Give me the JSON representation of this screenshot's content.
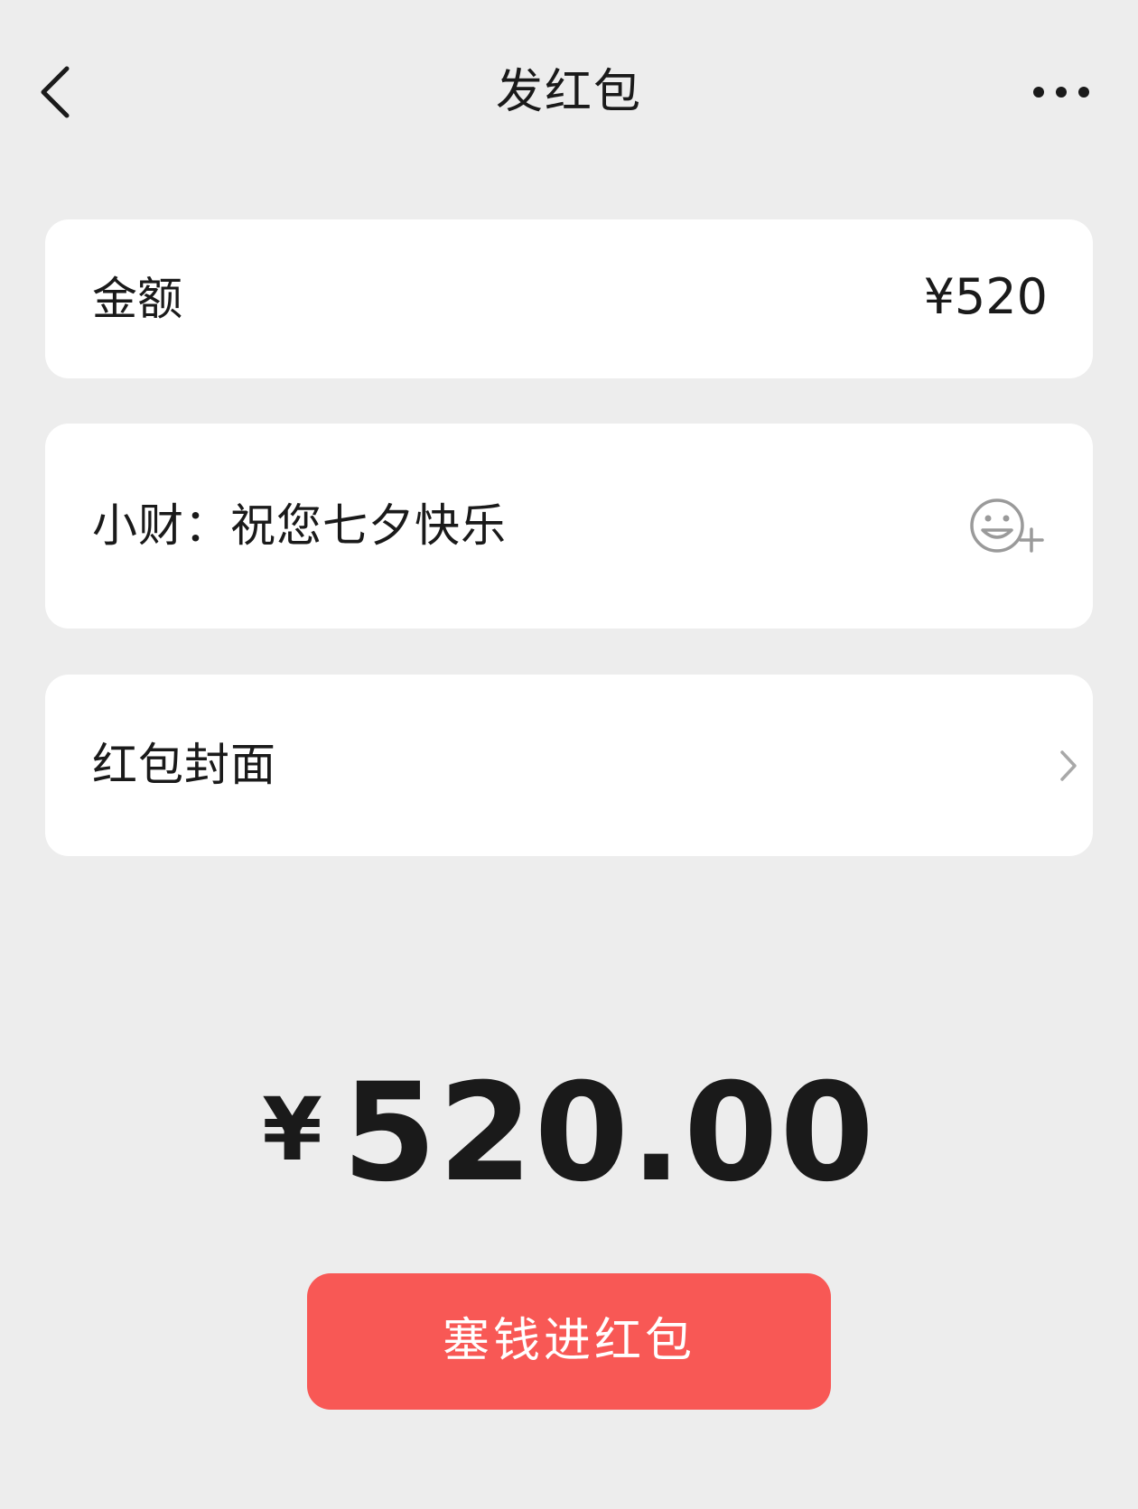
{
  "header": {
    "title": "发红包",
    "back_icon": "chevron-left-icon",
    "more_icon": "more-dots-icon"
  },
  "amount_card": {
    "label": "金额",
    "value": "¥520"
  },
  "greeting_card": {
    "text": "小财：祝您七夕快乐",
    "emoji_icon": "emoji-add-icon"
  },
  "cover_card": {
    "label": "红包封面",
    "chevron_icon": "chevron-right-icon"
  },
  "total": {
    "currency": "¥",
    "value": "520.00"
  },
  "send_button": {
    "label": "塞钱进红包"
  },
  "colors": {
    "background": "#ededed",
    "card": "#ffffff",
    "button": "#f85855",
    "text": "#1a1a1a"
  }
}
